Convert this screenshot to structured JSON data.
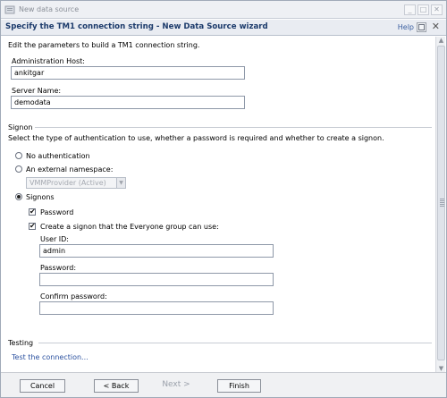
{
  "window": {
    "title": "New data source",
    "min_glyph": "_",
    "max_glyph": "□",
    "close_glyph": "✕"
  },
  "header": {
    "title": "Specify the TM1 connection string - New Data Source wizard",
    "help": "Help",
    "close_glyph": "✕"
  },
  "intro": "Edit the parameters to build a TM1 connection string.",
  "fields": {
    "admin_host": {
      "label": "Administration Host:",
      "value": "ankitgar"
    },
    "server_name": {
      "label": "Server Name:",
      "value": "demodata"
    }
  },
  "signon": {
    "heading": "Signon",
    "description": "Select the type of authentication to use, whether a password is required and whether to create a signon.",
    "options": {
      "no_auth": "No authentication",
      "external": "An external namespace:",
      "signons": "Signons"
    },
    "selected": "signons",
    "namespace_select": "VMMProvider (Active)",
    "password_check": {
      "label": "Password",
      "checked": true
    },
    "everyone_check": {
      "label": "Create a signon that the Everyone group can use:",
      "checked": true
    },
    "user_id": {
      "label": "User ID:",
      "value": "admin"
    },
    "password": {
      "label": "Password:",
      "value": ""
    },
    "confirm_password": {
      "label": "Confirm password:",
      "value": ""
    },
    "check_glyph": "✔"
  },
  "testing": {
    "heading": "Testing",
    "link": "Test the connection..."
  },
  "footer": {
    "cancel": "Cancel",
    "back": "< Back",
    "next": "Next >",
    "finish": "Finish"
  },
  "colors": {
    "header_title": "#1b3a6b",
    "link": "#2c52a0",
    "disabled_text": "#9aa0aa"
  }
}
